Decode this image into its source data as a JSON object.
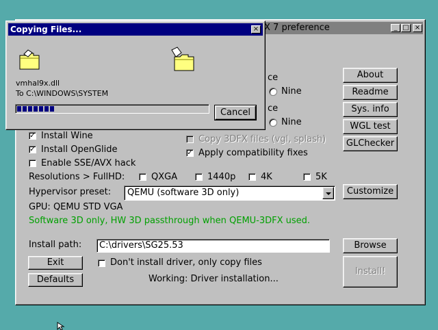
{
  "main_window": {
    "title_fragment": "X 7 preference",
    "title_buttons": [
      "_",
      "□",
      "×"
    ],
    "radio_labels": [
      "ce",
      "Nine",
      "ce",
      "Nine"
    ],
    "side_buttons": [
      "About",
      "Readme",
      "Sys. info",
      "WGL test",
      "GLChecker"
    ],
    "checkboxes": {
      "install_wine": {
        "label": "Install Wine",
        "checked": true
      },
      "install_openglide": {
        "label": "Install OpenGlide",
        "checked": true
      },
      "enable_sse": {
        "label": "Enable SSE/AVX hack",
        "checked": false
      },
      "copy_3dfx": {
        "label": "Copy 3DFX files (vgl, splash)",
        "checked": false,
        "disabled": true
      },
      "apply_fixes": {
        "label": "Apply compatibility fixes",
        "checked": true
      }
    },
    "resolutions_label": "Resolutions > FullHD:",
    "resolutions": [
      "QXGA",
      "1440p",
      "4K",
      "5K"
    ],
    "hypervisor_label": "Hypervisor preset:",
    "hypervisor_value": "QEMU (software 3D only)",
    "customize_label": "Customize",
    "gpu_text": "GPU:  QEMU STD VGA",
    "info_text": "Software 3D only, HW 3D passthrough when QEMU-3DFX used.",
    "info_color": "#00a000",
    "install_path_label": "Install path:",
    "install_path_value": "C:\\drivers\\SG25.53",
    "browse_label": "Browse",
    "exit_label": "Exit",
    "defaults_label": "Defaults",
    "copy_only_label": "Don't install driver, only copy files",
    "status_text": "Working: Driver installation...",
    "install_label": "Install!"
  },
  "copy_dialog": {
    "title": "Copying Files...",
    "close_glyph": "×",
    "file_name": "vmhal9x.dll",
    "destination": "To C:\\WINDOWS\\SYSTEM",
    "progress": 0.2,
    "cancel_label": "Cancel",
    "icons": [
      "folder-icon",
      "folder-icon",
      "flying-document-icon"
    ]
  },
  "colors": {
    "desktop": "#55aaaa",
    "title_active": "#000080",
    "title_inactive": "#808080",
    "progress": "#000080"
  }
}
